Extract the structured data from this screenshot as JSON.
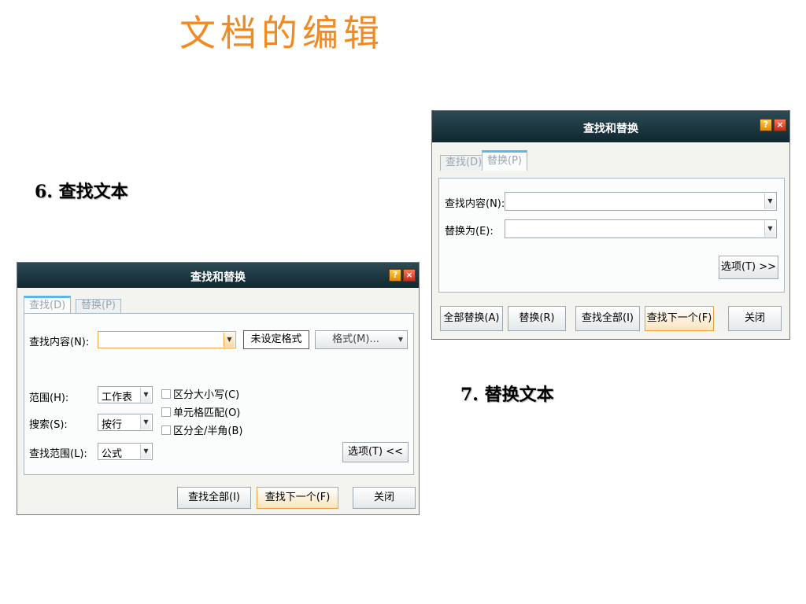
{
  "slide": {
    "title": "文档的编辑",
    "caption_find": "6. 查找文本",
    "caption_replace": "7. 替换文本"
  },
  "find_dialog": {
    "title": "查找和替换",
    "help": "?",
    "close": "×",
    "tab_find": "查找(D)",
    "tab_replace": "替换(P)",
    "find_label": "查找内容(N):",
    "find_value": "",
    "no_format": "未设定格式",
    "format_button": "格式(M)...",
    "scope_label": "范围(H):",
    "scope_value": "工作表",
    "search_label": "搜索(S):",
    "search_value": "按行",
    "lookin_label": "查找范围(L):",
    "lookin_value": "公式",
    "match_case": "区分大小写(C)",
    "match_cell": "单元格匹配(O)",
    "match_width": "区分全/半角(B)",
    "options_button": "选项(T) <<",
    "find_all": "查找全部(I)",
    "find_next": "查找下一个(F)",
    "close_button": "关闭"
  },
  "replace_dialog": {
    "title": "查找和替换",
    "help": "?",
    "close": "×",
    "tab_find": "查找(D)",
    "tab_replace": "替换(P)",
    "find_label": "查找内容(N):",
    "find_value": "",
    "replace_label": "替换为(E):",
    "replace_value": "",
    "options_button": "选项(T) >>",
    "replace_all": "全部替换(A)",
    "replace": "替换(R)",
    "find_all": "查找全部(I)",
    "find_next": "查找下一个(F)",
    "close_button": "关闭"
  }
}
